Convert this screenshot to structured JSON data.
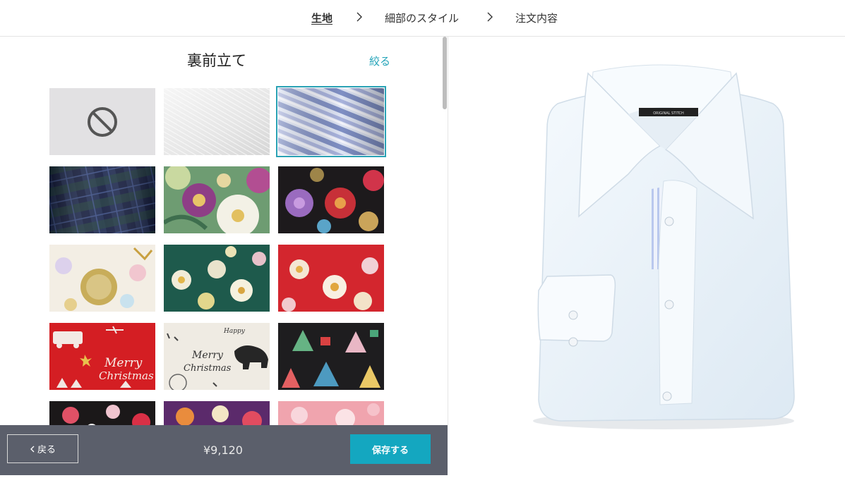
{
  "steps": [
    "生地",
    "細部のスタイル",
    "注文内容"
  ],
  "panel": {
    "title": "裏前立て",
    "filter_label": "絞る"
  },
  "swatches": [
    {
      "name": "none",
      "icon": "no-symbol-icon",
      "selected": false
    },
    {
      "name": "white-herringbone",
      "selected": false
    },
    {
      "name": "blue-stripe",
      "selected": true
    },
    {
      "name": "navy-tartan-check",
      "selected": false
    },
    {
      "name": "camellia-floral",
      "selected": false
    },
    {
      "name": "black-chrysanthemum",
      "selected": false
    },
    {
      "name": "white-gold-floral",
      "selected": false
    },
    {
      "name": "green-floral",
      "selected": false
    },
    {
      "name": "red-floral",
      "selected": false
    },
    {
      "name": "red-christmas",
      "selected": false
    },
    {
      "name": "white-bear-christmas",
      "selected": false
    },
    {
      "name": "black-christmas-tree",
      "selected": false
    },
    {
      "name": "black-cherry-blossom",
      "selected": false
    },
    {
      "name": "purple-floral",
      "selected": false
    },
    {
      "name": "pink-floral",
      "selected": false
    }
  ],
  "swatch_texts": {
    "merry1": "Merry",
    "merry2": "Christmas",
    "bear_merry": "Merry",
    "bear_christmas": "Christmas",
    "happy": "Happy"
  },
  "footer": {
    "back_label": "戻る",
    "price": "¥9,120",
    "save_label": "保存する"
  },
  "shirt": {
    "tag_text": "ORIGINAL STITCH",
    "body_color": "#eef5fb",
    "placket_stripe_color": "#b9c8ee"
  },
  "colors": {
    "accent": "#14a7c0",
    "footer_bg": "#5b5f6b",
    "selection": "#2aa2b5"
  }
}
